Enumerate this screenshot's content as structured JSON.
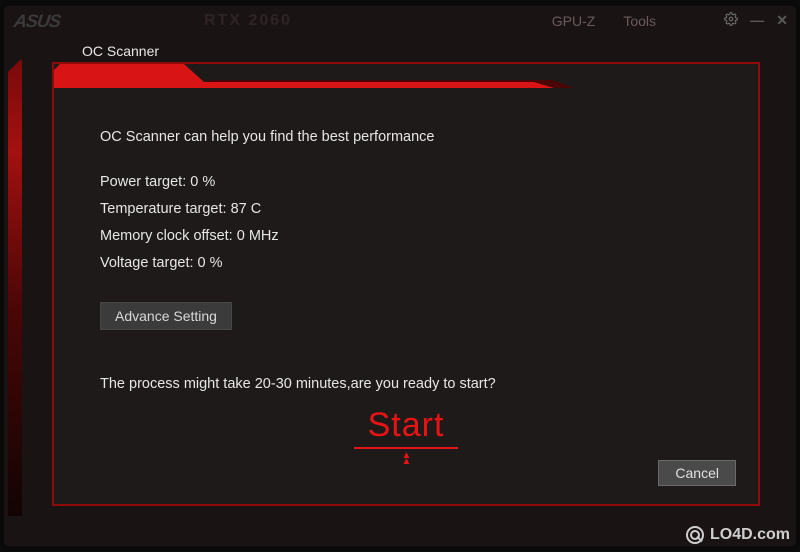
{
  "titlebar": {
    "logo": "ASUS",
    "gpu_name": "RTX 2060",
    "tabs": {
      "gpuz": "GPU-Z",
      "tools": "Tools"
    }
  },
  "dialog": {
    "title": "OC Scanner",
    "intro": "OC Scanner can help you find the best performance",
    "params": {
      "power_label": "Power target:",
      "power_value": "0 %",
      "temp_label": "Temperature target:",
      "temp_value": "87 C",
      "mem_label": "Memory clock offset:",
      "mem_value": "0 MHz",
      "volt_label": "Voltage target:",
      "volt_value": "0 %"
    },
    "advance_button": "Advance Setting",
    "confirm": "The process might take 20-30 minutes,are you ready to start?",
    "start_button": "Start",
    "cancel_button": "Cancel"
  },
  "watermark": "LO4D.com",
  "colors": {
    "accent_red": "#e81414",
    "border_red": "#8e0b0b",
    "bg_dark": "#1f1a1a"
  }
}
